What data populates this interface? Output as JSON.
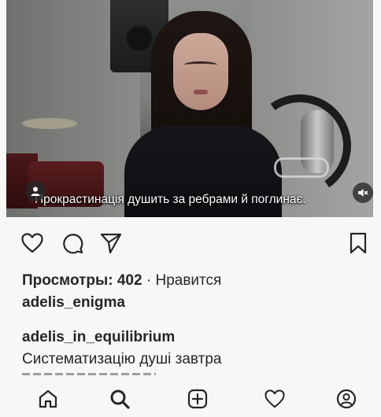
{
  "video": {
    "caption": "Прокрастинація душить за ребрами й поглинає.",
    "user_icon": "person-icon",
    "mute_icon": "muted-speaker-icon"
  },
  "actions": {
    "like_icon": "heart-outline-icon",
    "comment_icon": "comment-bubble-icon",
    "share_icon": "paper-plane-icon",
    "save_icon": "bookmark-icon"
  },
  "stats": {
    "views": "Просмотры: 402",
    "separator": "·",
    "likes_label": "Нравится",
    "liked_by": "adelis_enigma"
  },
  "post": {
    "author": "adelis_in_equilibrium",
    "caption": "Систематизацію душі завтра"
  },
  "bottom_nav": [
    {
      "name": "home",
      "icon": "home-icon"
    },
    {
      "name": "search",
      "icon": "search-icon"
    },
    {
      "name": "create",
      "icon": "plus-square-icon"
    },
    {
      "name": "activity",
      "icon": "heart-icon"
    },
    {
      "name": "profile",
      "icon": "profile-icon"
    }
  ],
  "colors": {
    "text": "#262626",
    "background": "#f7f7f5",
    "overlay_badge": "#262626"
  }
}
